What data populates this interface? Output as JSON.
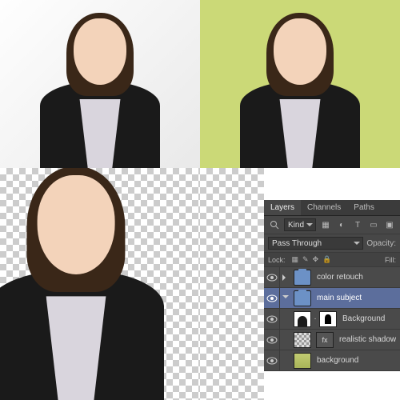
{
  "panel": {
    "tabs": [
      "Layers",
      "Channels",
      "Paths"
    ],
    "active_tab": "Layers",
    "filter": {
      "kind_label": "Kind"
    },
    "blend_mode": "Pass Through",
    "opacity_label": "Opacity:",
    "lock_label": "Lock:",
    "fill_label": "Fill:"
  },
  "layers": [
    {
      "name": "color retouch",
      "type": "group",
      "expanded": false,
      "selected": false
    },
    {
      "name": "main subject",
      "type": "group",
      "expanded": true,
      "selected": true
    },
    {
      "name": "Background",
      "type": "masked",
      "selected": false,
      "indent": 2
    },
    {
      "name": "realistic shadow",
      "type": "fx",
      "selected": false,
      "indent": 2
    },
    {
      "name": "background",
      "type": "fill",
      "selected": false,
      "indent": 2
    }
  ]
}
